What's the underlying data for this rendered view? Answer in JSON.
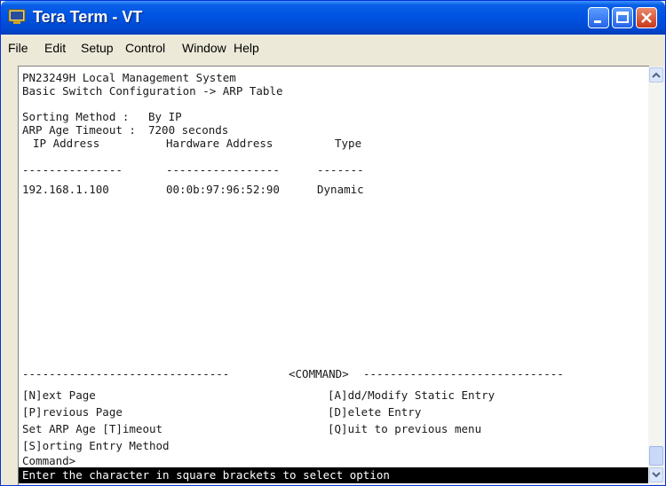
{
  "window": {
    "title": "Tera Term - VT",
    "icon": "tera-term-app-icon"
  },
  "menu": [
    "File",
    "Edit",
    "Setup",
    "Control",
    "Window",
    "Help"
  ],
  "terminal": {
    "header_line1": "PN23249H Local Management System",
    "header_line2": "Basic Switch Configuration -> ARP Table",
    "sorting_label": "Sorting Method :",
    "sorting_value": "By IP",
    "age_label": "ARP Age Timeout :",
    "age_value": "7200 seconds",
    "columns": [
      "IP Address",
      "Hardware Address",
      "Type"
    ],
    "col_dashes": [
      "---------------",
      "-----------------",
      "-------"
    ],
    "rows": [
      {
        "ip": "192.168.1.100",
        "mac": "00:0b:97:96:52:90",
        "type": "Dynamic"
      }
    ],
    "command_separator_left": "-------------------------------",
    "command_title": "<COMMAND>",
    "command_separator_right": "------------------------------",
    "commands_left": [
      "[N]ext Page",
      "[P]revious Page",
      "Set ARP Age [T]imeout",
      "[S]orting Entry Method"
    ],
    "commands_right": [
      "[A]dd/Modify Static Entry",
      "[D]elete Entry",
      "[Q]uit to previous menu"
    ],
    "prompt": "Command>",
    "status_message": "Enter the character in square brackets to select option"
  }
}
